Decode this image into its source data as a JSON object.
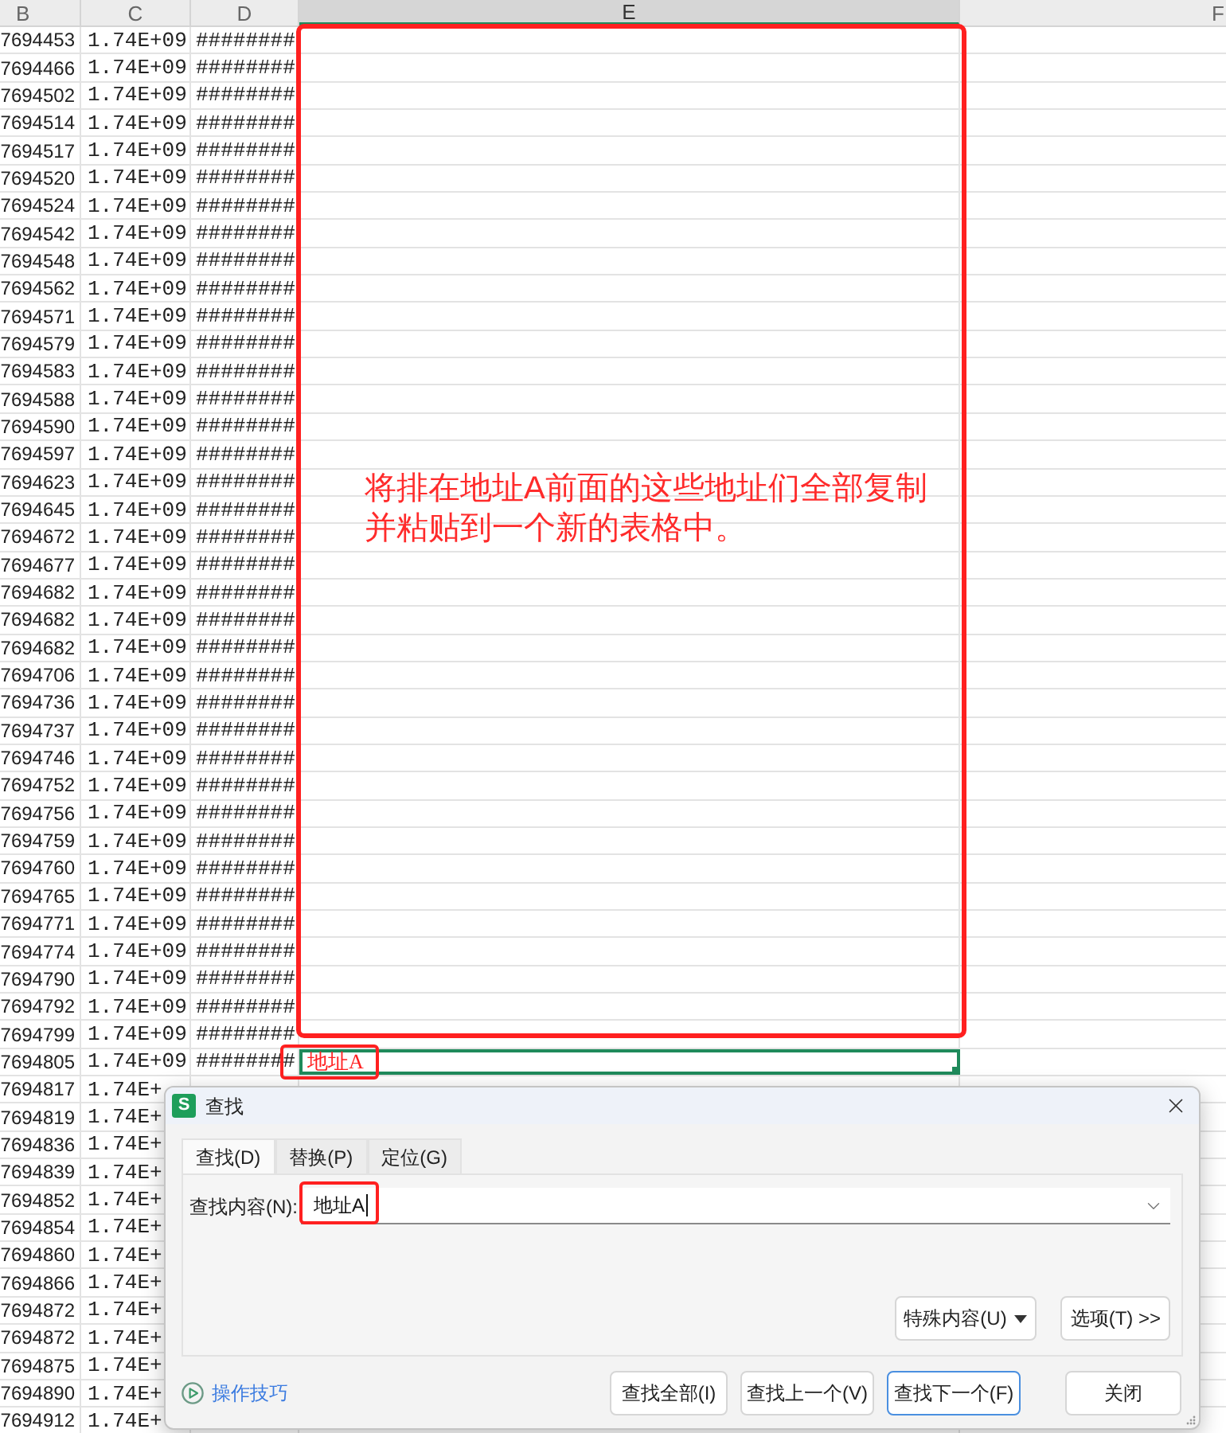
{
  "sheet": {
    "columns": [
      {
        "label": "B",
        "selected": false
      },
      {
        "label": "C",
        "selected": false
      },
      {
        "label": "D",
        "selected": false
      },
      {
        "label": "E",
        "selected": true
      },
      {
        "label": "F",
        "selected": false
      }
    ],
    "rows": [
      {
        "b": "7694453",
        "c": "1.74E+09",
        "d": "########",
        "selected": false
      },
      {
        "b": "7694466",
        "c": "1.74E+09",
        "d": "########",
        "selected": false
      },
      {
        "b": "7694502",
        "c": "1.74E+09",
        "d": "########",
        "selected": false
      },
      {
        "b": "7694514",
        "c": "1.74E+09",
        "d": "########",
        "selected": false
      },
      {
        "b": "7694517",
        "c": "1.74E+09",
        "d": "########",
        "selected": false
      },
      {
        "b": "7694520",
        "c": "1.74E+09",
        "d": "########",
        "selected": false
      },
      {
        "b": "7694524",
        "c": "1.74E+09",
        "d": "########",
        "selected": false
      },
      {
        "b": "7694542",
        "c": "1.74E+09",
        "d": "########",
        "selected": false
      },
      {
        "b": "7694548",
        "c": "1.74E+09",
        "d": "########",
        "selected": false
      },
      {
        "b": "7694562",
        "c": "1.74E+09",
        "d": "########",
        "selected": false
      },
      {
        "b": "7694571",
        "c": "1.74E+09",
        "d": "########",
        "selected": false
      },
      {
        "b": "7694579",
        "c": "1.74E+09",
        "d": "########",
        "selected": false
      },
      {
        "b": "7694583",
        "c": "1.74E+09",
        "d": "########",
        "selected": false
      },
      {
        "b": "7694588",
        "c": "1.74E+09",
        "d": "########",
        "selected": false
      },
      {
        "b": "7694590",
        "c": "1.74E+09",
        "d": "########",
        "selected": false
      },
      {
        "b": "7694597",
        "c": "1.74E+09",
        "d": "########",
        "selected": false
      },
      {
        "b": "7694623",
        "c": "1.74E+09",
        "d": "########",
        "selected": false
      },
      {
        "b": "7694645",
        "c": "1.74E+09",
        "d": "########",
        "selected": false
      },
      {
        "b": "7694672",
        "c": "1.74E+09",
        "d": "########",
        "selected": false
      },
      {
        "b": "7694677",
        "c": "1.74E+09",
        "d": "########",
        "selected": false
      },
      {
        "b": "7694682",
        "c": "1.74E+09",
        "d": "########",
        "selected": false
      },
      {
        "b": "7694682",
        "c": "1.74E+09",
        "d": "########",
        "selected": false
      },
      {
        "b": "7694682",
        "c": "1.74E+09",
        "d": "########",
        "selected": false
      },
      {
        "b": "7694706",
        "c": "1.74E+09",
        "d": "########",
        "selected": false
      },
      {
        "b": "7694736",
        "c": "1.74E+09",
        "d": "########",
        "selected": false
      },
      {
        "b": "7694737",
        "c": "1.74E+09",
        "d": "########",
        "selected": false
      },
      {
        "b": "7694746",
        "c": "1.74E+09",
        "d": "########",
        "selected": false
      },
      {
        "b": "7694752",
        "c": "1.74E+09",
        "d": "########",
        "selected": false
      },
      {
        "b": "7694756",
        "c": "1.74E+09",
        "d": "########",
        "selected": false
      },
      {
        "b": "7694759",
        "c": "1.74E+09",
        "d": "########",
        "selected": false
      },
      {
        "b": "7694760",
        "c": "1.74E+09",
        "d": "########",
        "selected": false
      },
      {
        "b": "7694765",
        "c": "1.74E+09",
        "d": "########",
        "selected": false
      },
      {
        "b": "7694771",
        "c": "1.74E+09",
        "d": "########",
        "selected": false
      },
      {
        "b": "7694774",
        "c": "1.74E+09",
        "d": "########",
        "selected": false
      },
      {
        "b": "7694790",
        "c": "1.74E+09",
        "d": "########",
        "selected": false
      },
      {
        "b": "7694792",
        "c": "1.74E+09",
        "d": "########",
        "selected": false
      },
      {
        "b": "7694799",
        "c": "1.74E+09",
        "d": "########",
        "selected": false
      },
      {
        "b": "7694805",
        "c": "1.74E+09",
        "d": "########",
        "e": "地址A",
        "selected": true
      },
      {
        "b": "7694817",
        "c": "1.74E+",
        "selected": false
      },
      {
        "b": "7694819",
        "c": "1.74E+",
        "selected": false
      },
      {
        "b": "7694836",
        "c": "1.74E+",
        "selected": false
      },
      {
        "b": "7694839",
        "c": "1.74E+",
        "selected": false
      },
      {
        "b": "7694852",
        "c": "1.74E+",
        "selected": false
      },
      {
        "b": "7694854",
        "c": "1.74E+",
        "selected": false
      },
      {
        "b": "7694860",
        "c": "1.74E+",
        "selected": false
      },
      {
        "b": "7694866",
        "c": "1.74E+",
        "selected": false
      },
      {
        "b": "7694872",
        "c": "1.74E+",
        "selected": false
      },
      {
        "b": "7694872",
        "c": "1.74E+",
        "selected": false
      },
      {
        "b": "7694875",
        "c": "1.74E+",
        "selected": false
      },
      {
        "b": "7694890",
        "c": "1.74E+",
        "selected": false
      },
      {
        "b": "7694912",
        "c": "1.74E+",
        "selected": false
      }
    ]
  },
  "annotation": {
    "note": "将排在地址A前面的这些地址们全部复制并粘贴到一个新的表格中。"
  },
  "dialog": {
    "app_icon": "S",
    "title": "查找",
    "tabs": [
      {
        "label": "查找(D)",
        "selected": true
      },
      {
        "label": "替换(P)",
        "selected": false
      },
      {
        "label": "定位(G)",
        "selected": false
      }
    ],
    "find_label": "查找内容(N):",
    "find_value": "地址A",
    "panel_buttons": [
      {
        "label": "特殊内容(U)",
        "kind": "dropdown"
      },
      {
        "label": "选项(T) >>",
        "kind": "plain"
      }
    ],
    "tips_link": "操作技巧",
    "buttons": [
      {
        "label": "查找全部(I)",
        "focused": false
      },
      {
        "label": "查找上一个(V)",
        "focused": false
      },
      {
        "label": "查找下一个(F)",
        "focused": true
      },
      {
        "label": "关闭",
        "focused": false
      }
    ]
  }
}
